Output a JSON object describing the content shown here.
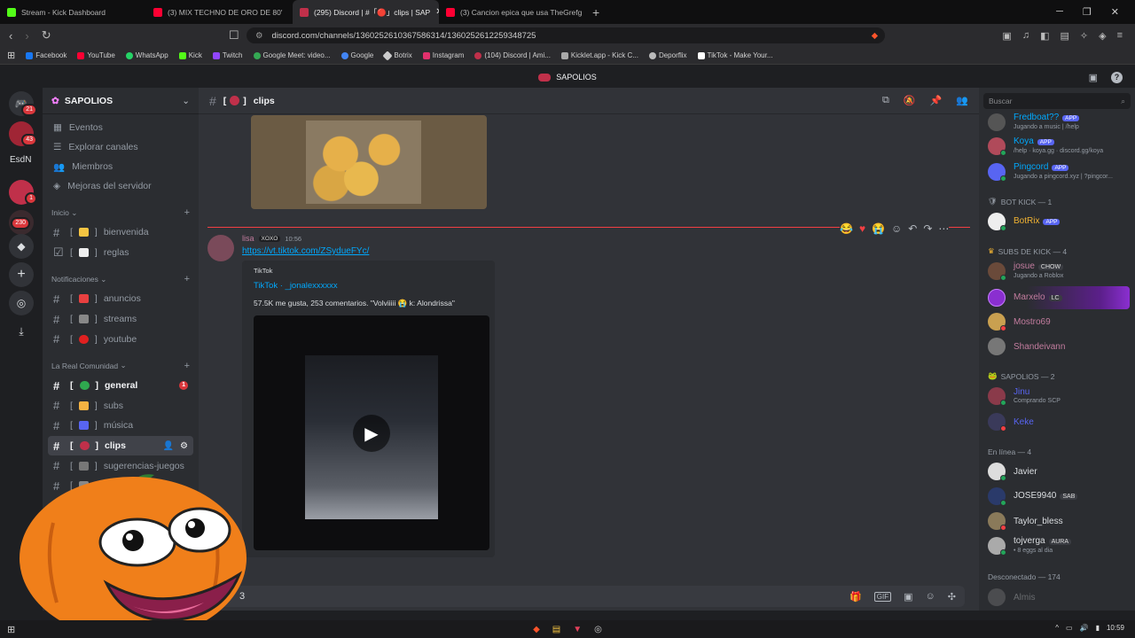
{
  "browser": {
    "tabs": [
      {
        "title": "Stream - Kick Dashboard",
        "color": "#53fc18"
      },
      {
        "title": "(3) MIX TECHNO DE ORO DE 80'",
        "color": "#ff0033"
      },
      {
        "title": "(295) Discord | #「🔴」clips | SAP",
        "color": "#c0304a"
      },
      {
        "title": "(3) Cancion epica que usa TheGrefg",
        "color": "#ff0033"
      }
    ],
    "url": "discord.com/channels/1360252610367586314/1360252612259348725",
    "bookmarks": [
      {
        "label": "Facebook",
        "color": "#1877f2"
      },
      {
        "label": "YouTube",
        "color": "#ff0033"
      },
      {
        "label": "WhatsApp",
        "color": "#25d366"
      },
      {
        "label": "Kick",
        "color": "#53fc18"
      },
      {
        "label": "Twitch",
        "color": "#9146ff"
      },
      {
        "label": "Google Meet: video...",
        "color": "#34a853"
      },
      {
        "label": "Google",
        "color": "#4285f4"
      },
      {
        "label": "Botrix",
        "color": "#cccccc"
      },
      {
        "label": "Instagram",
        "color": "#e1306c"
      },
      {
        "label": "(104) Discord | Ami...",
        "color": "#c0304a"
      },
      {
        "label": "Kicklet.app - Kick C...",
        "color": "#aaaaaa"
      },
      {
        "label": "Deporflix",
        "color": "#bbbbbb"
      },
      {
        "label": "TikTok - Make Your...",
        "color": "#ffffff"
      }
    ]
  },
  "server_title": "SAPOLIOS",
  "guilds": {
    "badges": [
      "21",
      "43",
      "1",
      "230"
    ],
    "label": "EsdN"
  },
  "sidebar": {
    "server": "SAPOLIOS",
    "items": [
      "Eventos",
      "Explorar canales",
      "Miembros",
      "Mejoras del servidor"
    ],
    "cat1": "Inicio",
    "cat1_channels": [
      {
        "name": "bienvenida",
        "emo": "#f5c542"
      },
      {
        "name": "reglas",
        "emo": "#eeeeee"
      }
    ],
    "cat2": "Notificaciones",
    "cat2_channels": [
      {
        "name": "anuncios",
        "emo": "#e84040"
      },
      {
        "name": "streams",
        "emo": "#888888"
      },
      {
        "name": "youtube",
        "emo": "#e02020"
      }
    ],
    "cat3": "La Real Comunidad",
    "cat3_channels": [
      {
        "name": "general",
        "emo": "#2fa84f",
        "unread": "1"
      },
      {
        "name": "subs",
        "emo": "#f5b342"
      },
      {
        "name": "música",
        "emo": "#5865f2"
      },
      {
        "name": "clips",
        "emo": "#c0304a"
      },
      {
        "name": "sugerencias-juegos",
        "emo": "#777777"
      },
      {
        "name": "novedades",
        "emo": "#888888"
      }
    ]
  },
  "channel": {
    "name": "clips",
    "bracket_left": "[",
    "bracket_right": "]"
  },
  "message": {
    "author": "lisa",
    "tag": "XOXO",
    "time": "10:56",
    "link": "https://vt.tiktok.com/ZSydueFYc/",
    "embed_provider": "TikTok",
    "embed_title": "TikTok · _jonalexxxxxx",
    "embed_desc": "57.5K me gusta, 253 comentarios. \"Volviiiii 😭 k: Alondrissa\""
  },
  "composer_value": "3",
  "search_placeholder": "Buscar",
  "members": {
    "partial_top": "Fredboat??",
    "koya": {
      "name": "Koya",
      "sub": "/help · koya.gg · discord.gg/koya"
    },
    "partial_sub": "Jugando a music | /help",
    "pingcord": {
      "name": "Pingcord",
      "sub": "Jugando a pingcord.xyz | ?pingcor..."
    },
    "app_tag": "APP",
    "cat_bot": "BOT KICK — 1",
    "botrix": "BotRix",
    "cat_subs": "SUBS DE KICK — 4",
    "josue": {
      "name": "josue",
      "tag": "CHOW",
      "sub": "Jugando a Roblox"
    },
    "marxelo": {
      "name": "Marxelo",
      "tag": "LC"
    },
    "mostro": "Mostro69",
    "shandeivann": "Shandeivann",
    "cat_sapolios": "SAPOLIOS — 2",
    "jinu": {
      "name": "Jinu",
      "sub": "Comprando SCP"
    },
    "keke": "Keke",
    "cat_online": "En línea — 4",
    "javier": "Javier",
    "jose": {
      "name": "JOSE9940",
      "tag": "SAB"
    },
    "taylor": "Taylor_bless",
    "tojverga": {
      "name": "tojverga",
      "tag": "AURA",
      "sub": "• 8 eggs al dia"
    },
    "cat_offline": "Desconectado — 174",
    "offline1": "Almis"
  },
  "taskbar": {
    "time": "10:59"
  }
}
